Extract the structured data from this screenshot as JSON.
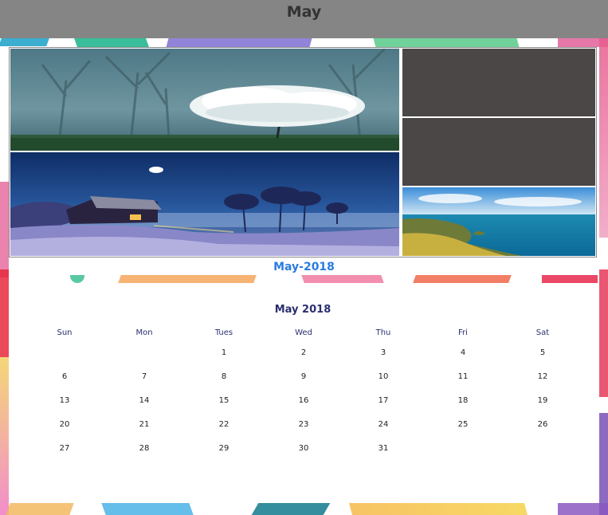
{
  "header": {
    "title": "May"
  },
  "caption": "May-2018",
  "calendar": {
    "title": "May 2018",
    "weekdays": [
      "Sun",
      "Mon",
      "Tues",
      "Wed",
      "Thu",
      "Fri",
      "Sat"
    ],
    "weeks": [
      [
        "",
        "",
        "1",
        "2",
        "3",
        "4",
        "5"
      ],
      [
        "6",
        "7",
        "8",
        "9",
        "10",
        "11",
        "12"
      ],
      [
        "13",
        "14",
        "15",
        "16",
        "17",
        "18",
        "19"
      ],
      [
        "20",
        "21",
        "22",
        "23",
        "24",
        "25",
        "26"
      ],
      [
        "27",
        "28",
        "29",
        "30",
        "31",
        "",
        ""
      ]
    ]
  },
  "colors": {
    "topbar": "#858585",
    "caption": "#2a7be0",
    "calendar_title": "#2a2f6e",
    "placeholder": "#4a4746"
  }
}
